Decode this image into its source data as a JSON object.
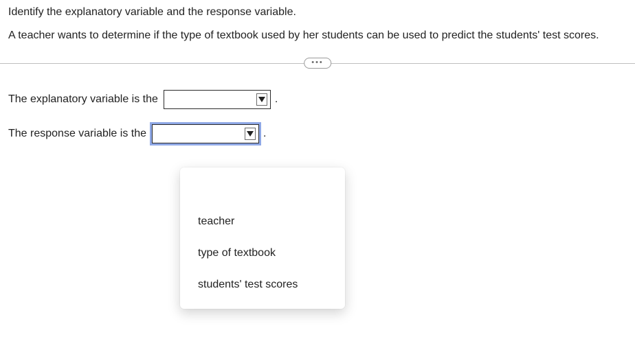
{
  "question": {
    "instruction": "Identify the explanatory variable and the response variable.",
    "stem": "A teacher wants to determine if the type of textbook used by her students can be used to predict the students' test scores."
  },
  "divider": {
    "dots": "•••"
  },
  "row1": {
    "prefix": "The explanatory variable is the",
    "value": "",
    "suffix": "."
  },
  "row2": {
    "prefix": "The response variable is the",
    "value": "",
    "suffix": "."
  },
  "menu": {
    "options": [
      "teacher",
      "type of textbook",
      "students' test scores"
    ]
  }
}
